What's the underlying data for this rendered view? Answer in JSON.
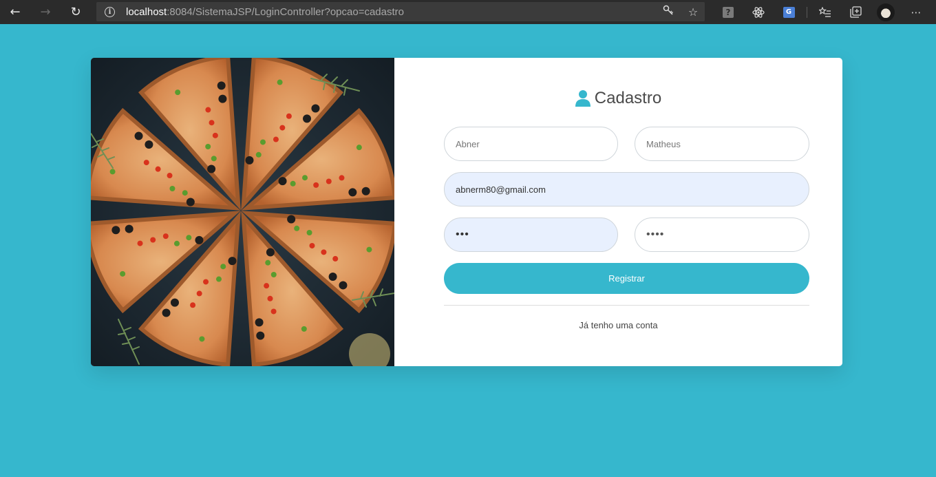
{
  "browser": {
    "url_host": "localhost",
    "url_rest": ":8084/SistemaJSP/LoginController?opcao=cadastro"
  },
  "colors": {
    "background": "#36b7cd",
    "accent": "#36b7cd",
    "autofill": "#e8f0fe"
  },
  "icons": {
    "back": "back-arrow-icon",
    "forward": "forward-arrow-icon",
    "refresh": "refresh-icon",
    "info": "info-icon",
    "title": "user-icon"
  },
  "form": {
    "title": "Cadastro",
    "first_name": {
      "placeholder": "Abner"
    },
    "last_name": {
      "placeholder": "Matheus"
    },
    "email": {
      "value": "abnerm80@gmail.com"
    },
    "password": {
      "value": "•••"
    },
    "confirm_password": {
      "value": "••••"
    },
    "submit_label": "Registrar",
    "login_link": "Já tenho uma conta"
  }
}
